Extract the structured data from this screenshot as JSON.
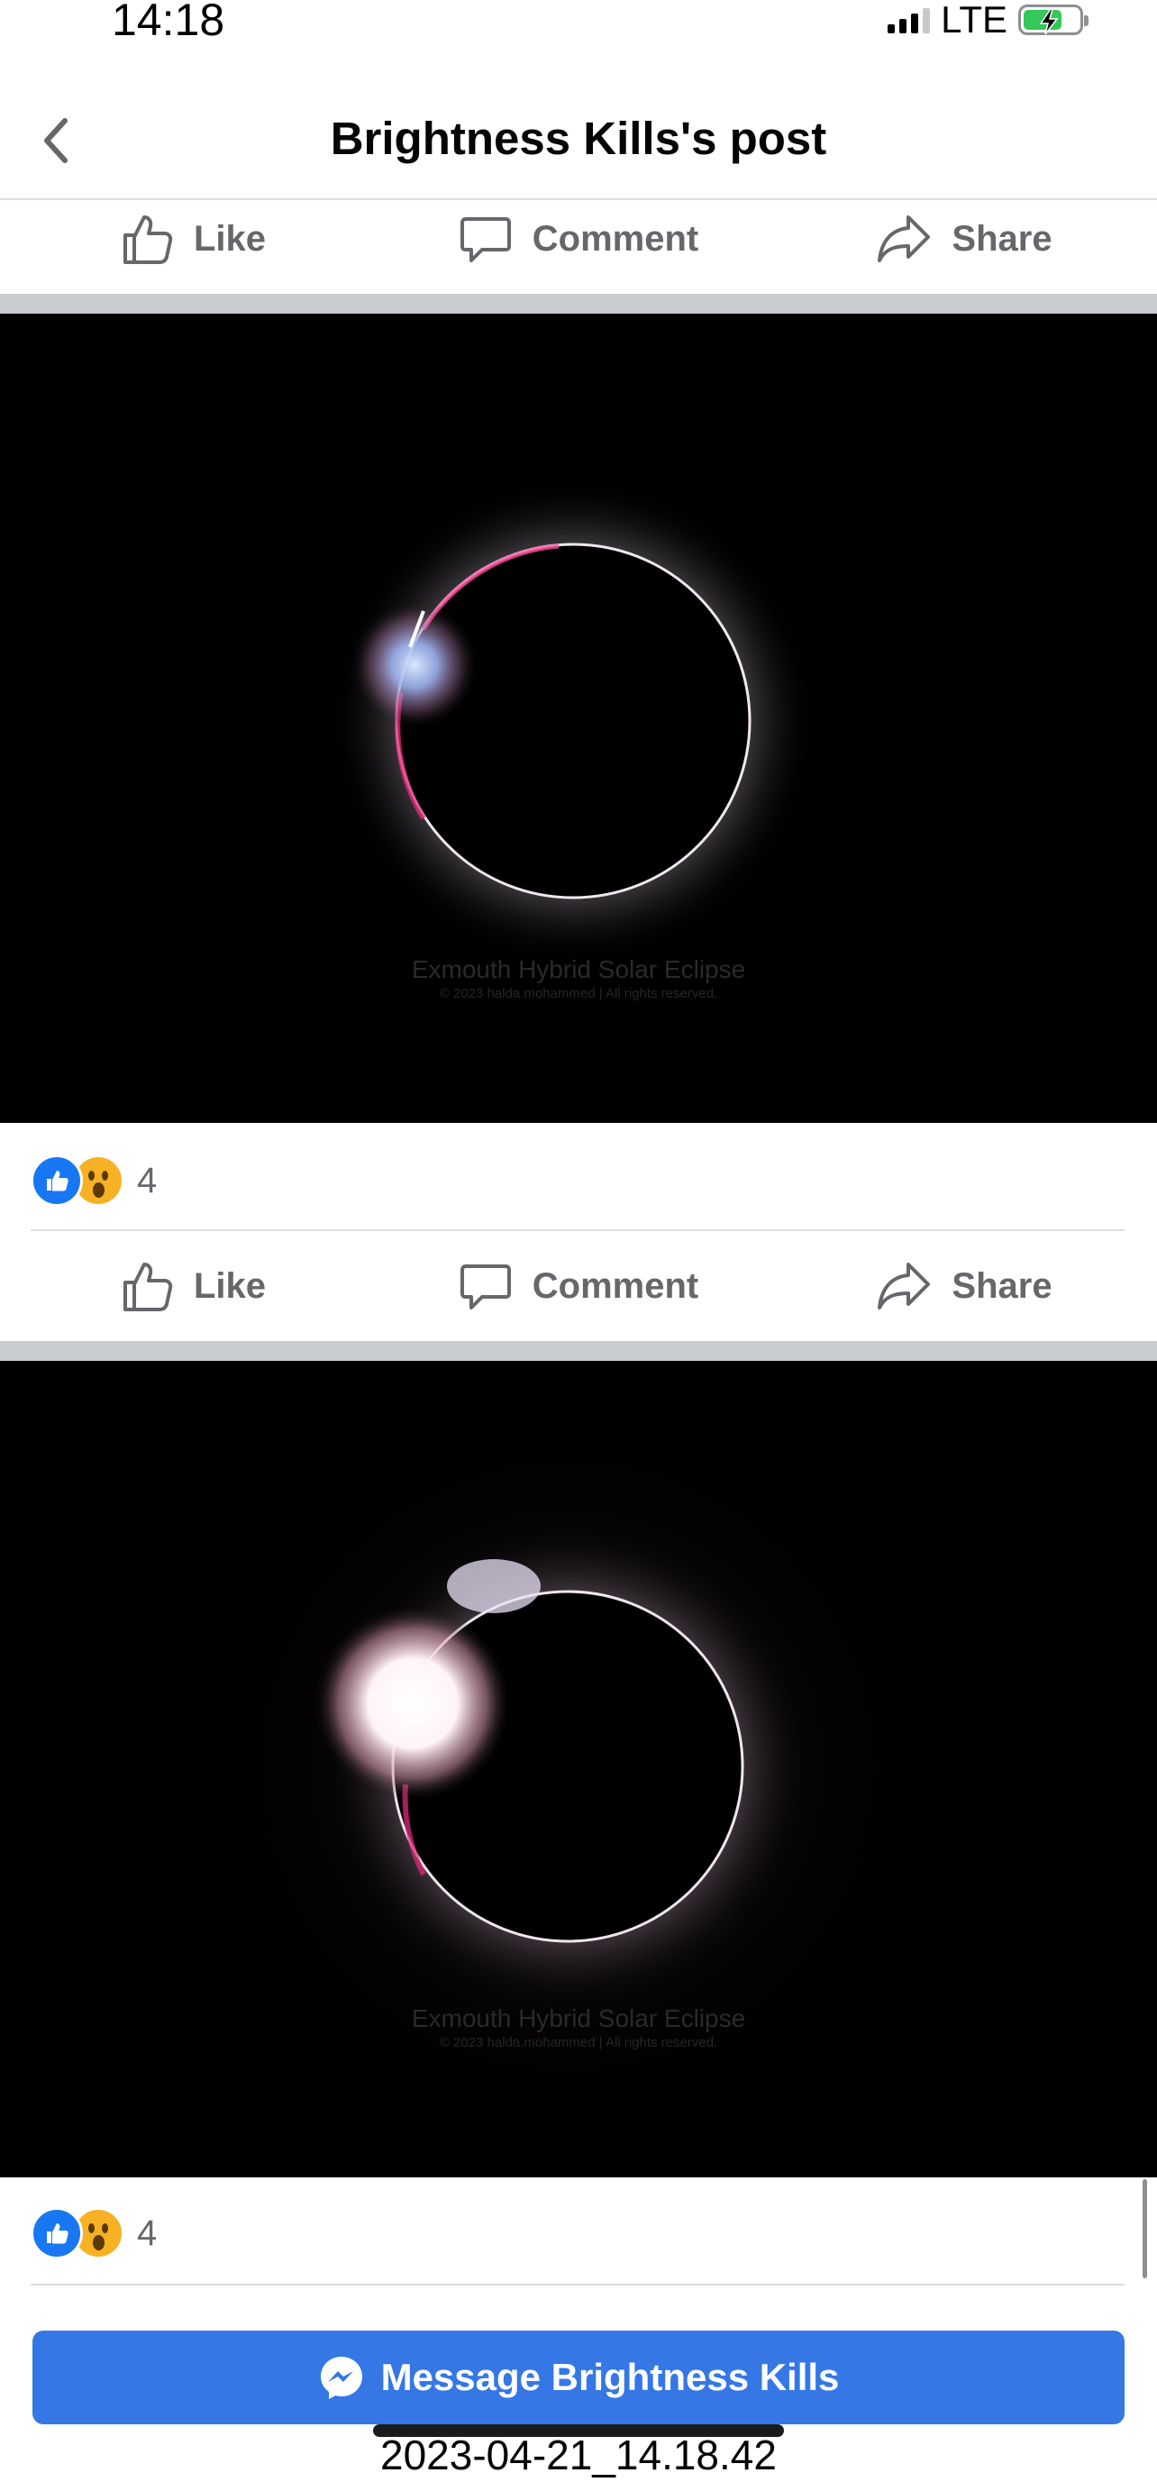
{
  "status_bar": {
    "time": "14:18",
    "network": "LTE",
    "signal_bars": 3,
    "battery_charging": true
  },
  "header": {
    "title": "Brightness Kills's post",
    "back_icon": "chevron-left-icon"
  },
  "actions": {
    "like": "Like",
    "comment": "Comment",
    "share": "Share"
  },
  "posts": [
    {
      "image": {
        "subject": "solar-eclipse-diamond-ring",
        "watermark_title": "Exmouth Hybrid Solar Eclipse",
        "watermark_credit": "© 2023 halda.mohammed | All rights reserved."
      },
      "reactions": {
        "types": [
          "like",
          "wow"
        ],
        "count": "4"
      }
    },
    {
      "image": {
        "subject": "solar-eclipse-diamond-ring",
        "watermark_title": "Exmouth Hybrid Solar Eclipse",
        "watermark_credit": "© 2023 halda.mohammed | All rights reserved."
      },
      "reactions": {
        "types": [
          "like",
          "wow"
        ],
        "count": "4"
      }
    }
  ],
  "message_button": {
    "label": "Message Brightness Kills",
    "icon": "messenger-icon"
  },
  "caption": "2023-04-21_14.18.42",
  "colors": {
    "accent": "#3578e5",
    "like": "#1877f2",
    "wow": "#f7b125",
    "action_text": "#65676b",
    "separator": "#c9ccd1"
  }
}
